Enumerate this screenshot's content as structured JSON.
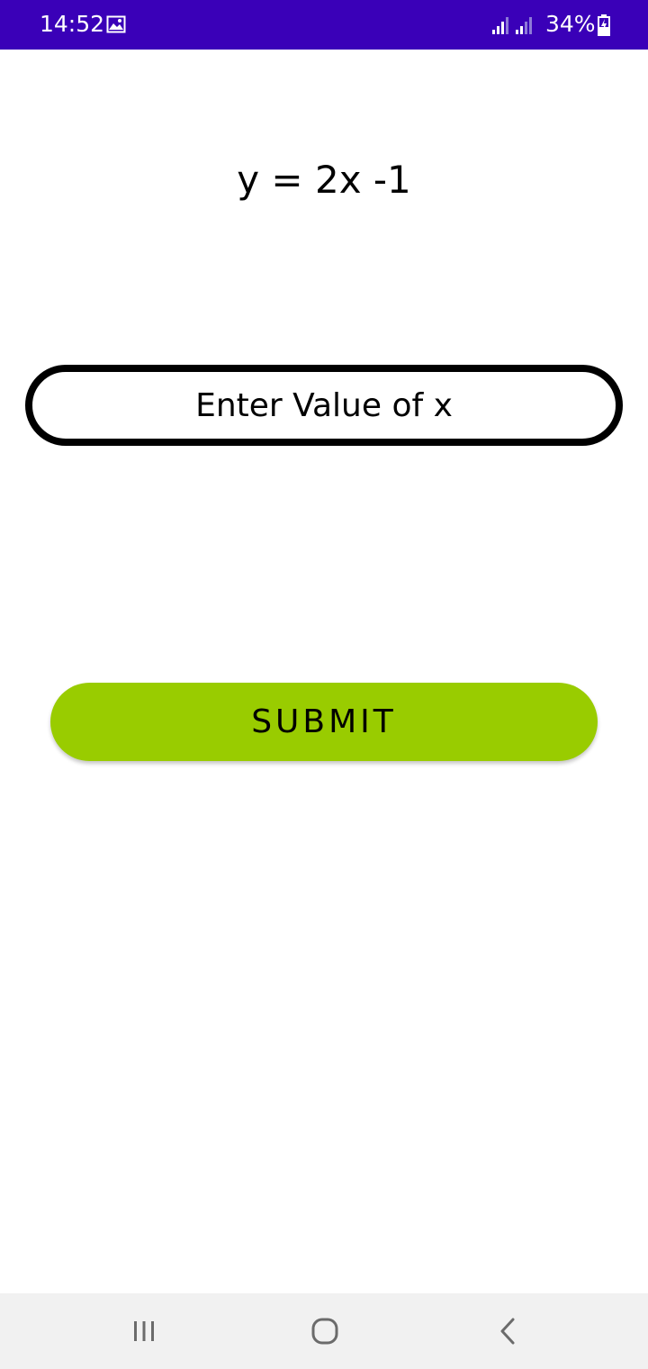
{
  "status_bar": {
    "time": "14:52",
    "battery": "34%",
    "background_color": "#3a00b8",
    "icons": [
      "gallery-icon",
      "signal-icon",
      "signal-icon",
      "battery-charging-icon"
    ]
  },
  "main": {
    "equation": "y = 2x -1",
    "input": {
      "placeholder": "Enter Value of x",
      "value": ""
    },
    "submit_label": "SUBMIT",
    "submit_color": "#99cc00"
  },
  "nav_bar": {
    "icons": [
      "recent-apps-icon",
      "home-icon",
      "back-icon"
    ]
  }
}
